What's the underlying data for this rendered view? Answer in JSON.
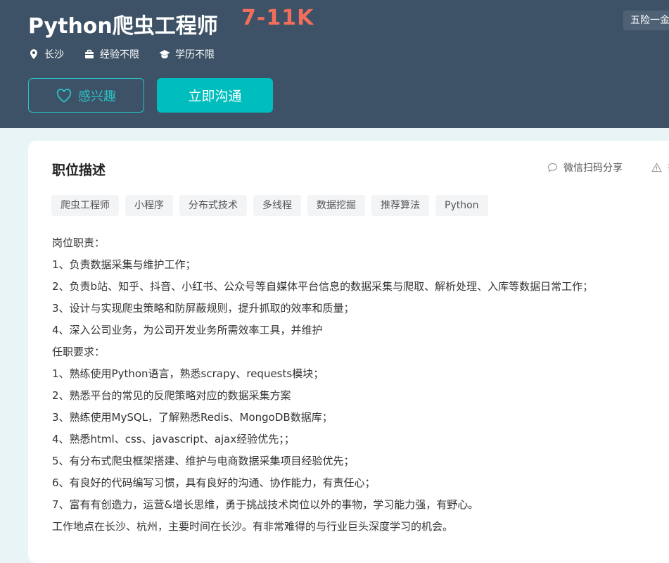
{
  "header": {
    "title": "Python爬虫工程师",
    "salary": "7-11K",
    "benefit_badge": "五险一金",
    "meta": {
      "location": "长沙",
      "experience": "经验不限",
      "education": "学历不限"
    },
    "fav_button": "感兴趣",
    "chat_button": "立即沟通"
  },
  "section": {
    "title": "职位描述",
    "share": "微信扫码分享",
    "report": "举报"
  },
  "tags": [
    "爬虫工程师",
    "小程序",
    "分布式技术",
    "多线程",
    "数据挖掘",
    "推荐算法",
    "Python"
  ],
  "description": [
    "岗位职责：",
    "1、负责数据采集与维护工作；",
    "2、负责b站、知乎、抖音、小红书、公众号等自媒体平台信息的数据采集与爬取、解析处理、入库等数据日常工作；",
    "3、设计与实现爬虫策略和防屏蔽规则，提升抓取的效率和质量；",
    "4、深入公司业务，为公司开发业务所需效率工具，并维护",
    "任职要求：",
    "1、熟练使用Python语言，熟悉scrapy、requests模块；",
    "2、熟悉平台的常见的反爬策略对应的数据采集方案",
    "3、熟练使用MySQL，了解熟悉Redis、MongoDB数据库；",
    "4、熟悉html、css、javascript、ajax经验优先；；",
    "5、有分布式爬虫框架搭建、维护与电商数据采集项目经验优先；",
    "6、有良好的代码编写习惯，具有良好的沟通、协作能力，有责任心；",
    "7、富有有创造力，运营&增长思维，勇于挑战技术岗位以外的事物，学习能力强，有野心。",
    "工作地点在长沙、杭州，主要时间在长沙。有非常难得的与行业巨头深度学习的机会。"
  ],
  "colors": {
    "header_bg": "#3d5266",
    "accent": "#00bebd",
    "salary": "#f26d5b"
  },
  "icons": {
    "location": "location-pin-icon",
    "experience": "briefcase-icon",
    "education": "graduation-cap-icon",
    "fav": "heart-icon",
    "share": "chat-bubble-icon",
    "report": "warning-triangle-icon"
  }
}
